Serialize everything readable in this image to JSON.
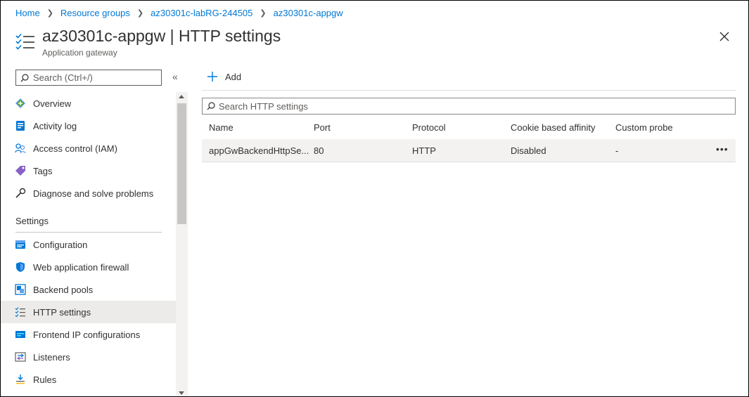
{
  "breadcrumb": {
    "items": [
      "Home",
      "Resource groups",
      "az30301c-labRG-244505",
      "az30301c-appgw"
    ]
  },
  "header": {
    "title": "az30301c-appgw | HTTP settings",
    "subtitle": "Application gateway"
  },
  "sidebar": {
    "search_placeholder": "Search (Ctrl+/)",
    "collapse_label": "«",
    "items": [
      {
        "label": "Overview",
        "icon": "overview-icon"
      },
      {
        "label": "Activity log",
        "icon": "activity-log-icon"
      },
      {
        "label": "Access control (IAM)",
        "icon": "access-control-icon"
      },
      {
        "label": "Tags",
        "icon": "tag-icon"
      },
      {
        "label": "Diagnose and solve problems",
        "icon": "wrench-icon"
      }
    ],
    "section_settings": "Settings",
    "settings_items": [
      {
        "label": "Configuration",
        "icon": "configuration-icon"
      },
      {
        "label": "Web application firewall",
        "icon": "shield-icon"
      },
      {
        "label": "Backend pools",
        "icon": "backend-pools-icon"
      },
      {
        "label": "HTTP settings",
        "icon": "http-settings-icon",
        "active": true
      },
      {
        "label": "Frontend IP configurations",
        "icon": "frontend-ip-icon"
      },
      {
        "label": "Listeners",
        "icon": "listeners-icon"
      },
      {
        "label": "Rules",
        "icon": "rules-icon"
      }
    ]
  },
  "toolbar": {
    "add_label": "Add"
  },
  "main": {
    "search_placeholder": "Search HTTP settings",
    "columns": [
      "Name",
      "Port",
      "Protocol",
      "Cookie based affinity",
      "Custom probe"
    ],
    "rows": [
      {
        "name": "appGwBackendHttpSe...",
        "port": "80",
        "protocol": "HTTP",
        "affinity": "Disabled",
        "probe": "-",
        "more": "•••"
      }
    ]
  },
  "colors": {
    "accent": "#0078d4",
    "active_bg": "#edebe9"
  }
}
